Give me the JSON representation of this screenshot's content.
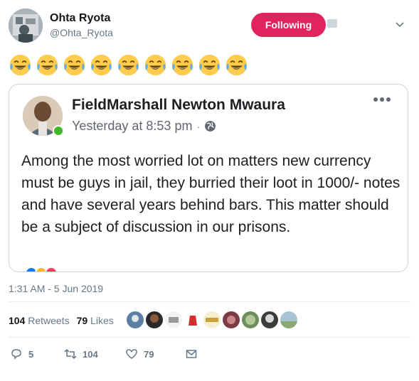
{
  "author": {
    "name": "Ohta Ryota",
    "handle": "@Ohta_Ryota",
    "follow_label": "Following"
  },
  "emoji_row": {
    "emoji": "face-with-tears-of-joy",
    "count": 9
  },
  "quoted_post": {
    "name": "FieldMarshall Newton Mwaura",
    "time": "Yesterday at 8:53 pm",
    "separator": "·",
    "audience_icon": "globe-icon",
    "text": "Among the most worried lot on matters new currency must be guys in jail, they burried their loot in 1000/- notes and have several years behind bars. This matter should be a subject of discussion in our prisons."
  },
  "tweet": {
    "timestamp": "1:31 AM - 5 Jun 2019",
    "retweets_count": "104",
    "retweets_label": "Retweets",
    "likes_count": "79",
    "likes_label": "Likes"
  },
  "actions": {
    "reply_count": "5",
    "retweet_count": "104",
    "like_count": "79"
  },
  "colors": {
    "follow_button": "#e0245e",
    "secondary_text": "#657786",
    "online_indicator": "#42b72a"
  }
}
